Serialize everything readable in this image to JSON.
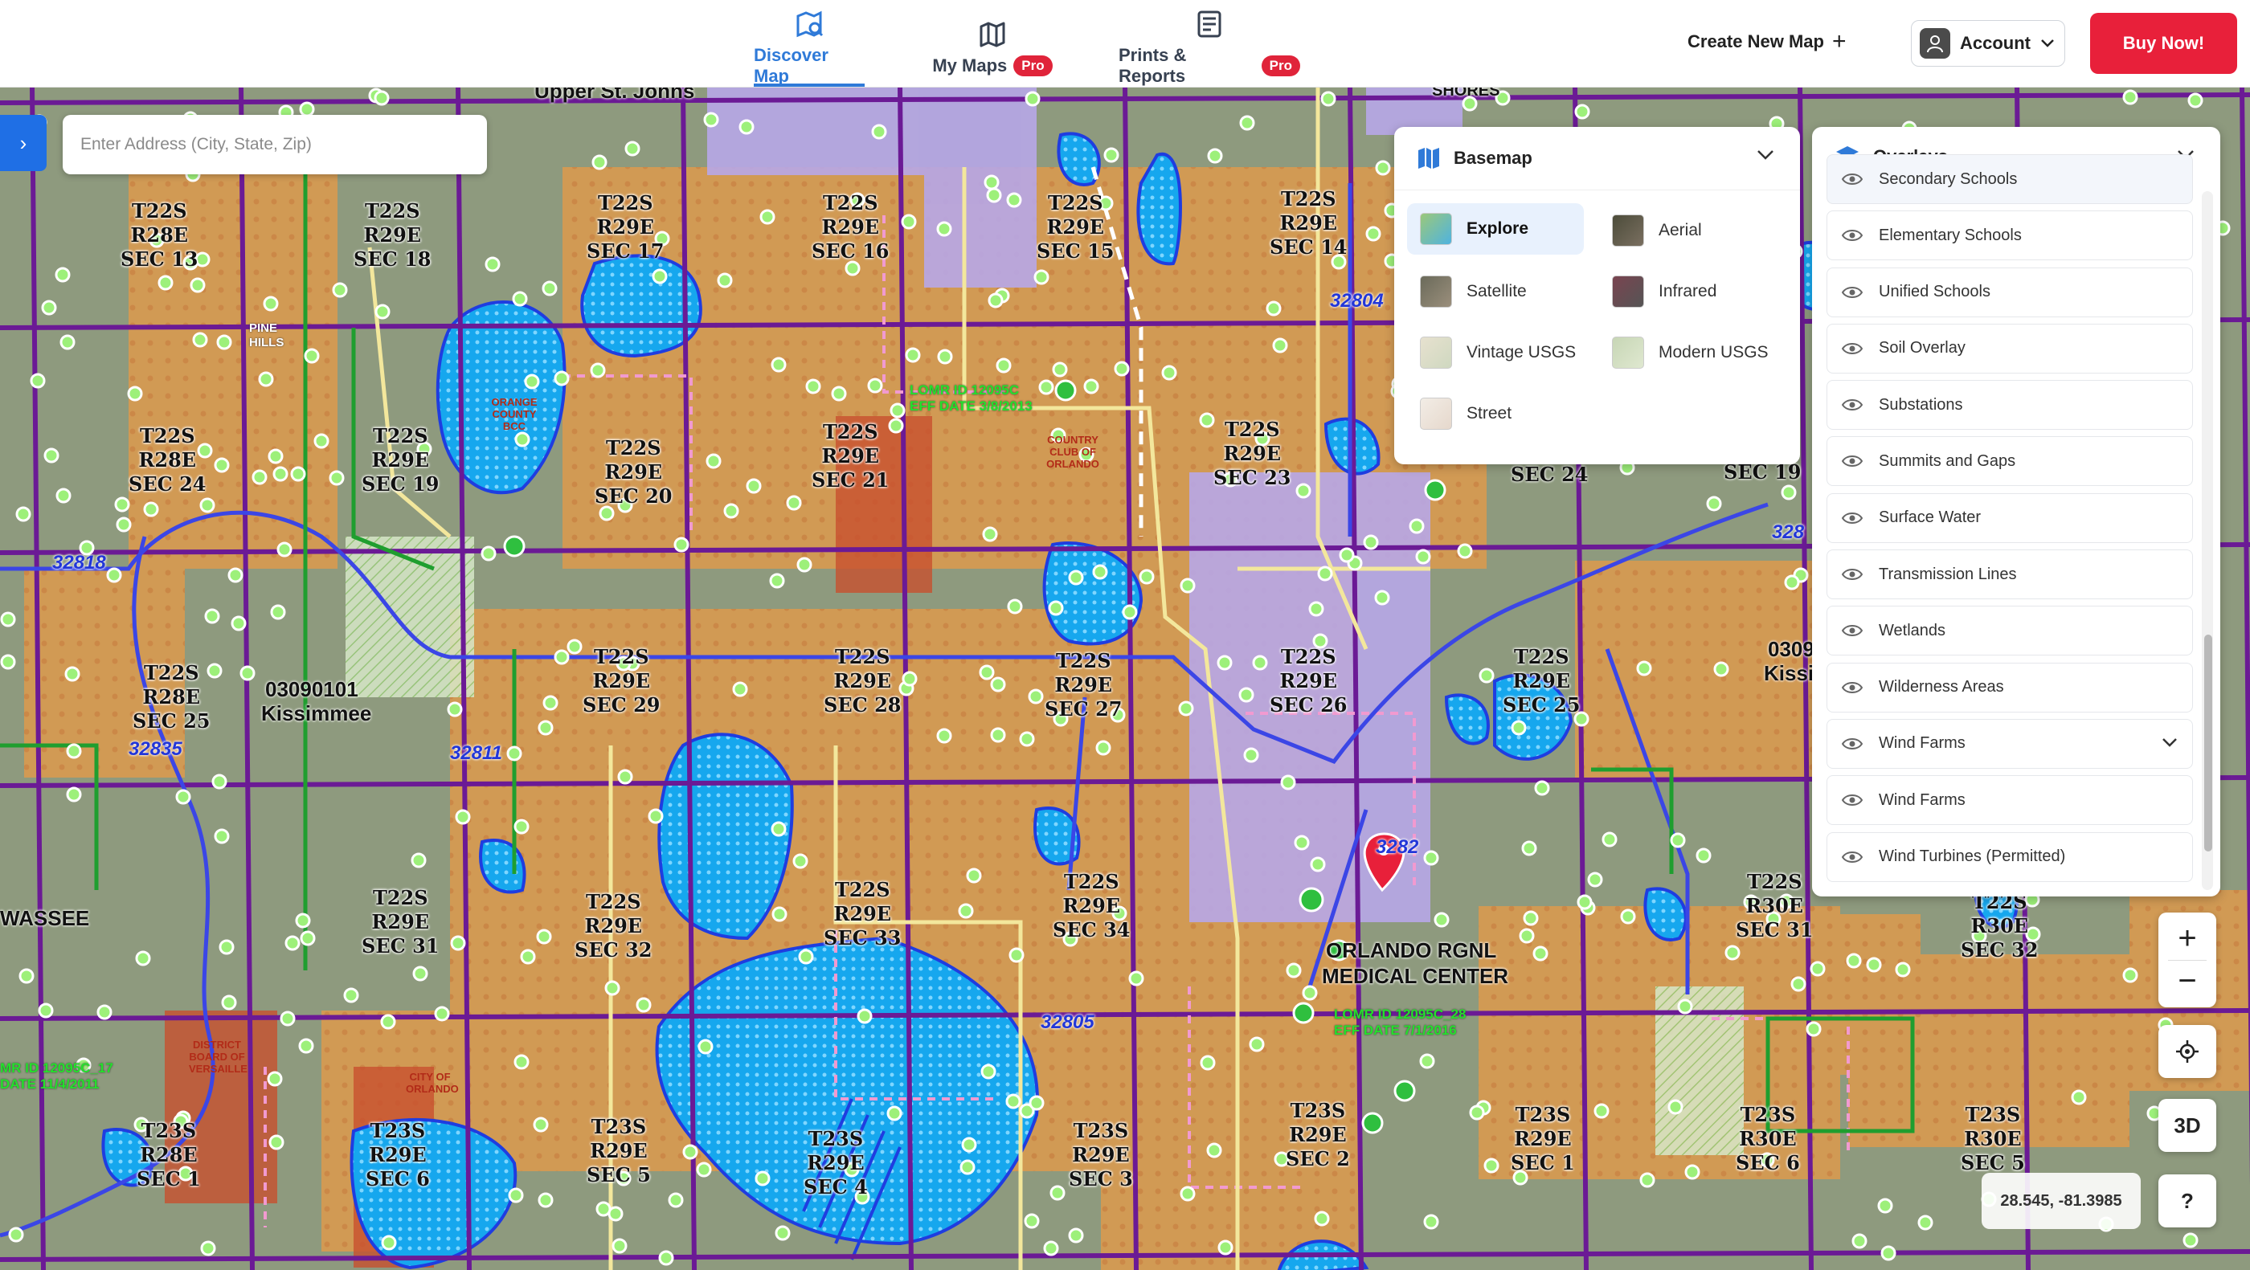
{
  "nav": {
    "tabs": [
      {
        "label": "Discover Map",
        "icon": "map-search-icon",
        "active": true,
        "pro": false
      },
      {
        "label": "My Maps",
        "icon": "folded-map-icon",
        "active": false,
        "pro": true
      },
      {
        "label": "Prints & Reports",
        "icon": "report-icon",
        "active": false,
        "pro": true
      }
    ],
    "pro_badge": "Pro",
    "create_new_map": "Create New Map",
    "account": "Account",
    "buy_now": "Buy Now!"
  },
  "colors": {
    "accent": "#2f7ad8",
    "buy_now": "#e8203a",
    "water": "#1aa8f0",
    "parcel_orange": "#d99a4a",
    "section_line": "#7a1f9e",
    "road_yellow": "#f2e59a",
    "well_dot": "#8ef46a"
  },
  "search": {
    "placeholder": "Enter Address (City, State, Zip)"
  },
  "basemap": {
    "title": "Basemap",
    "options": [
      {
        "label": "Explore",
        "active": true
      },
      {
        "label": "Aerial",
        "active": false
      },
      {
        "label": "Satellite",
        "active": false
      },
      {
        "label": "Infrared",
        "active": false
      },
      {
        "label": "Vintage USGS",
        "active": false
      },
      {
        "label": "Modern USGS",
        "active": false
      },
      {
        "label": "Street",
        "active": false
      }
    ]
  },
  "overlays": {
    "title": "Overlays",
    "items": [
      {
        "label": "Secondary Schools"
      },
      {
        "label": "Elementary Schools"
      },
      {
        "label": "Unified Schools"
      },
      {
        "label": "Soil Overlay"
      },
      {
        "label": "Substations"
      },
      {
        "label": "Summits and Gaps"
      },
      {
        "label": "Surface Water"
      },
      {
        "label": "Transmission Lines"
      },
      {
        "label": "Wetlands"
      },
      {
        "label": "Wilderness Areas"
      },
      {
        "label": "Wind Farms",
        "expandable": true
      },
      {
        "label": "Wind Farms"
      },
      {
        "label": "Wind Turbines (Permitted)"
      }
    ]
  },
  "map_controls": {
    "zoom_in": "+",
    "zoom_out": "−",
    "three_d": "3D",
    "help": "?",
    "coordinates": "28.545, -81.3985"
  },
  "map_labels": {
    "sections": [
      [
        "T22S",
        "R28E",
        "SEC 13"
      ],
      [
        "T22S",
        "R29E",
        "SEC 18"
      ],
      [
        "T22S",
        "R29E",
        "SEC 17"
      ],
      [
        "T22S",
        "R29E",
        "SEC 16"
      ],
      [
        "T22S",
        "R29E",
        "SEC 15"
      ],
      [
        "T22S",
        "R29E",
        "SEC 14"
      ],
      [
        "T22S",
        "R28E",
        "SEC 24"
      ],
      [
        "T22S",
        "R29E",
        "SEC 19"
      ],
      [
        "T22S",
        "R29E",
        "SEC 20"
      ],
      [
        "T22S",
        "R29E",
        "SEC 21"
      ],
      [
        "T22S",
        "R29E",
        "SEC 23"
      ],
      [
        "T22S",
        "R28E",
        "SEC 25"
      ],
      [
        "T22S",
        "R29E",
        "SEC 29"
      ],
      [
        "T22S",
        "R29E",
        "SEC 28"
      ],
      [
        "T22S",
        "R29E",
        "SEC 27"
      ],
      [
        "T22S",
        "R29E",
        "SEC 26"
      ],
      [
        "T22S",
        "R29E",
        "SEC 25"
      ],
      [
        "T22S",
        "R29E",
        "SEC 31"
      ],
      [
        "T22S",
        "R29E",
        "SEC 32"
      ],
      [
        "T22S",
        "R29E",
        "SEC 33"
      ],
      [
        "T22S",
        "R29E",
        "SEC 34"
      ],
      [
        "T23S",
        "R28E",
        "SEC 1"
      ],
      [
        "T23S",
        "R29E",
        "SEC 6"
      ],
      [
        "T23S",
        "R29E",
        "SEC 5"
      ],
      [
        "T23S",
        "R29E",
        "SEC 4"
      ],
      [
        "T23S",
        "R29E",
        "SEC 3"
      ],
      [
        "T23S",
        "R29E",
        "SEC 2"
      ],
      [
        "T23S",
        "R29E",
        "SEC 1"
      ],
      [
        "T23S",
        "R30E",
        "SEC 6"
      ],
      [
        "T23S",
        "R30E",
        "SEC 5"
      ],
      [
        "T22S",
        "R30E",
        "SEC 31"
      ],
      [
        "T22S",
        "R30E",
        "SEC 32"
      ]
    ],
    "places": [
      "Upper St. Johns",
      "03090101",
      "Kissimmee",
      "ORLANDO RGNL",
      "MEDICAL CENTER",
      "WASSEE",
      "0309",
      "Kissin",
      "SHORES",
      "SEC 24",
      "SEC 19"
    ],
    "zip_codes": [
      "32804",
      "32818",
      "32835",
      "32811",
      "32805",
      "3282",
      "328"
    ],
    "flood_zone": [
      "LOMR ID 12095C",
      "EFF DATE 3/8/2013",
      "LOMR ID 12095C_28",
      "EFF DATE 7/1/2016",
      "MR ID 12095C_17",
      "DATE 11/4/2011"
    ],
    "facilities": [
      "ORANGE COUNTY BCC",
      "COUNTRY CLUB OF ORLANDO",
      "CITY OF ORLANDO",
      "DISTRICT BOARD OF VERSAILLE",
      "PINE HILLS"
    ]
  }
}
